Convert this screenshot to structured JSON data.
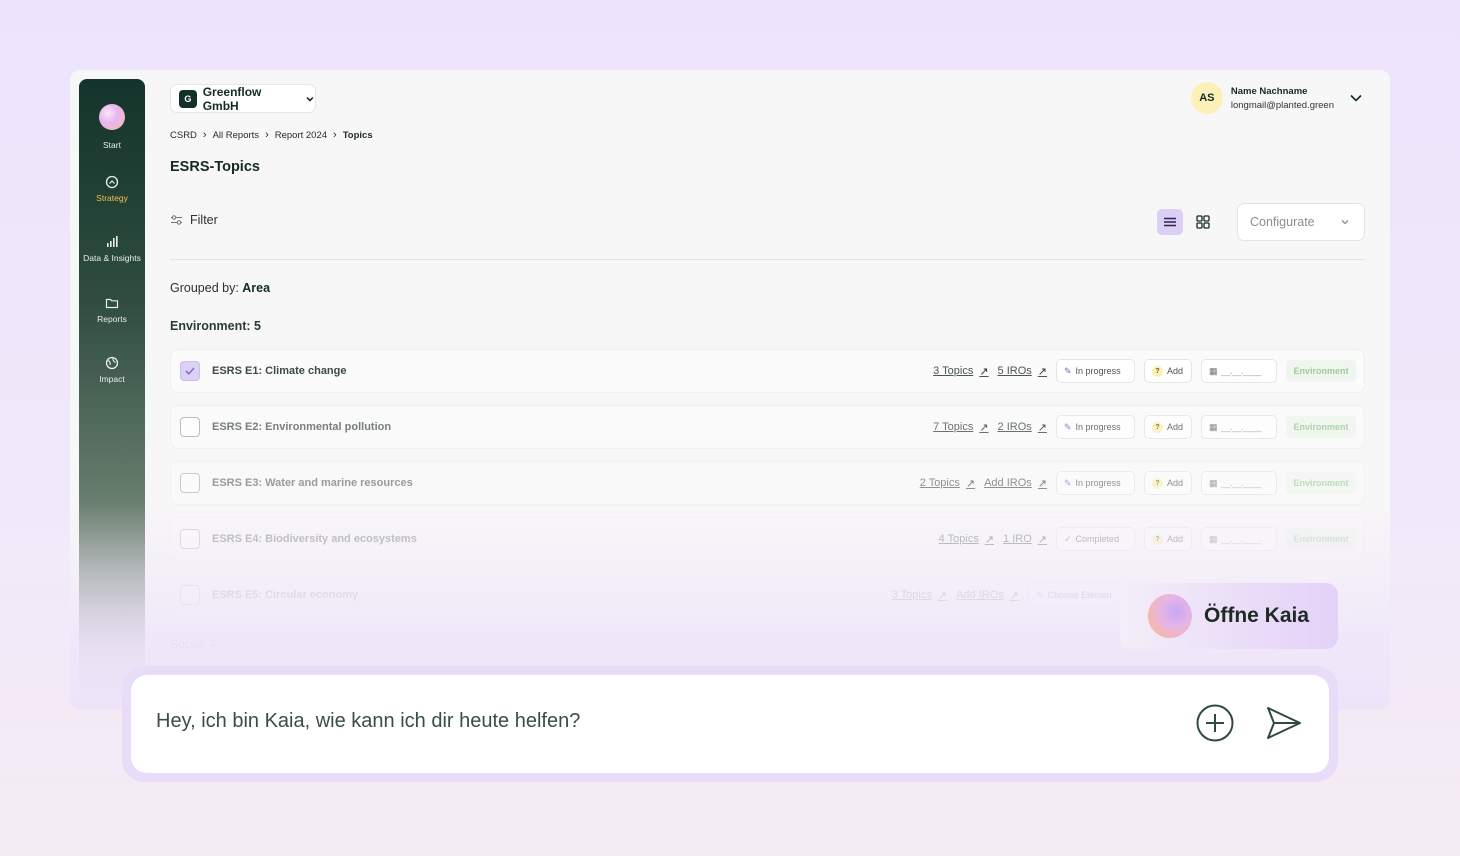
{
  "sidebar": {
    "items": [
      {
        "label": "Start",
        "icon": "orb-icon"
      },
      {
        "label": "Strategy",
        "icon": "compass-icon",
        "active": true
      },
      {
        "label": "Data & Insights",
        "icon": "bar-chart-icon"
      },
      {
        "label": "Reports",
        "icon": "folder-icon"
      },
      {
        "label": "Impact",
        "icon": "globe-icon"
      }
    ]
  },
  "header": {
    "company_initial": "G",
    "company_name": "Greenflow GmbH",
    "user_initials": "AS",
    "user_name": "Name Nachname",
    "user_email": "longmail@planted.green"
  },
  "breadcrumb": [
    "CSRD",
    "All Reports",
    "Report 2024",
    "Topics"
  ],
  "page_title": "ESRS-Topics",
  "toolbar": {
    "filter_label": "Filter",
    "configurate_label": "Configurate"
  },
  "grouped": {
    "prefix": "Grouped by:",
    "value": "Area"
  },
  "section": {
    "title": "Environment: 5",
    "next_title": "Social: 4"
  },
  "rows": [
    {
      "title": "ESRS E1: Climate change",
      "topics": "3 Topics",
      "iros": "5 IROs",
      "status": "In progress",
      "add": "Add",
      "date": "__.__.____",
      "tag": "Environment",
      "checked": true
    },
    {
      "title": "ESRS E2: Environmental pollution",
      "topics": "7 Topics",
      "iros": "2 IROs",
      "status": "In progress",
      "add": "Add",
      "date": "__.__.____",
      "tag": "Environment",
      "checked": false
    },
    {
      "title": "ESRS E3: Water and marine resources",
      "topics": "2 Topics",
      "iros": "Add IROs",
      "status": "In progress",
      "add": "Add",
      "date": "__.__.____",
      "tag": "Environment",
      "checked": false
    },
    {
      "title": "ESRS E4: Biodiversity and ecosystems",
      "topics": "4 Topics",
      "iros": "1 IRO",
      "status": "Completed",
      "add": "Add",
      "date": "__.__.____",
      "tag": "Environment",
      "checked": false
    },
    {
      "title": "ESRS E5: Circular economy",
      "topics": "3 Topics",
      "iros": "Add IROs",
      "status": "Choose Elemen",
      "checked": false
    }
  ],
  "kaia": {
    "open_label": "Öffne Kaia"
  },
  "chat": {
    "placeholder": "Hey, ich bin Kaia, wie kann ich dir heute helfen?"
  },
  "colors": {
    "accent": "#dccff6",
    "dark_green": "#14302a",
    "tag_green": "#9ccc9b"
  }
}
